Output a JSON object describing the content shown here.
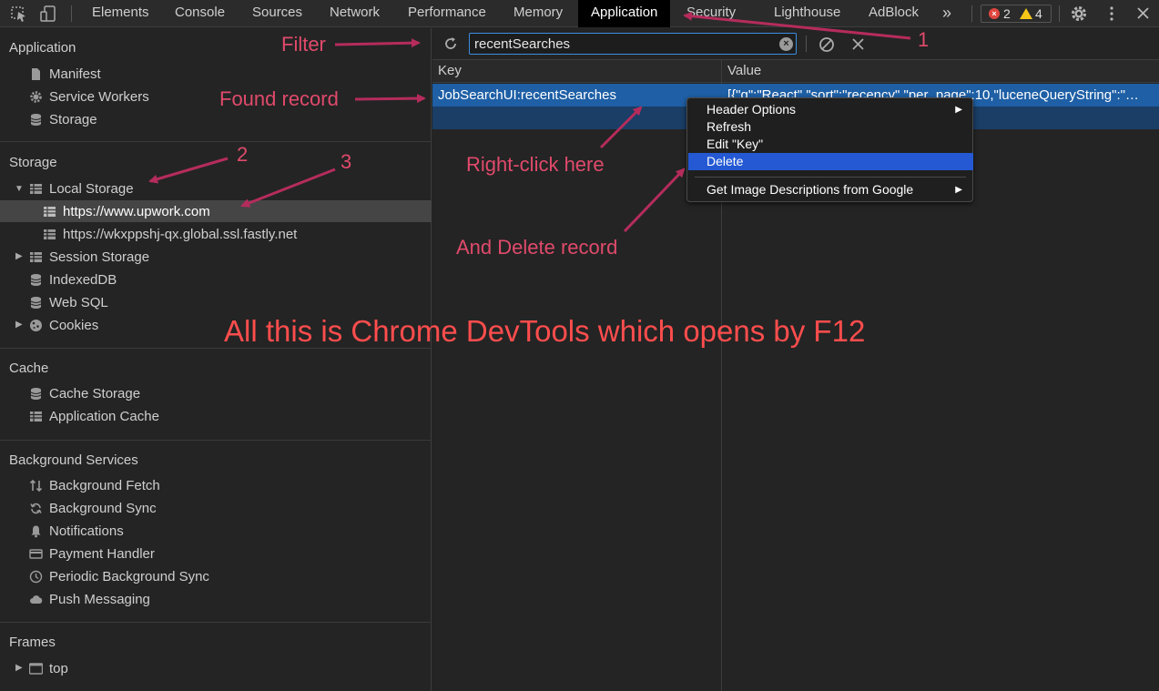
{
  "toolbar": {
    "tabs": [
      "Elements",
      "Console",
      "Sources",
      "Network",
      "Performance",
      "Memory",
      "Application",
      "Security",
      "Lighthouse",
      "AdBlock"
    ],
    "more": "»",
    "errors": "2",
    "warnings": "4"
  },
  "sidebar": {
    "application": {
      "title": "Application",
      "items": [
        "Manifest",
        "Service Workers",
        "Storage"
      ]
    },
    "storage": {
      "title": "Storage",
      "local_storage": "Local Storage",
      "local_children": [
        "https://www.upwork.com",
        "https://wkxppshj-qx.global.ssl.fastly.net"
      ],
      "session_storage": "Session Storage",
      "indexeddb": "IndexedDB",
      "websql": "Web SQL",
      "cookies": "Cookies"
    },
    "cache": {
      "title": "Cache",
      "items": [
        "Cache Storage",
        "Application Cache"
      ]
    },
    "background": {
      "title": "Background Services",
      "items": [
        "Background Fetch",
        "Background Sync",
        "Notifications",
        "Payment Handler",
        "Periodic Background Sync",
        "Push Messaging"
      ]
    },
    "frames": {
      "title": "Frames",
      "top": "top"
    }
  },
  "main": {
    "filter_value": "recentSearches",
    "columns": {
      "key": "Key",
      "value": "Value"
    },
    "rows": [
      {
        "key": "JobSearchUI:recentSearches",
        "value": "[{\"q\":\"React\",\"sort\":\"recency\",\"per_page\":10,\"luceneQueryString\":\"…"
      }
    ]
  },
  "context_menu": {
    "items": [
      "Header Options",
      "Refresh",
      "Edit \"Key\"",
      "Delete",
      "Get Image Descriptions from Google"
    ]
  },
  "annotations": {
    "filter": "Filter",
    "found": "Found record",
    "right_click": "Right-click here",
    "delete": "And Delete record",
    "n1": "1",
    "n2": "2",
    "n3": "3",
    "big": "All this is Chrome DevTools which opens by F12"
  },
  "colors": {
    "annotation": "#e04a6b",
    "big_note": "#ff4d4d",
    "selection": "#1e5fa5",
    "menu_highlight": "#2459d3"
  }
}
